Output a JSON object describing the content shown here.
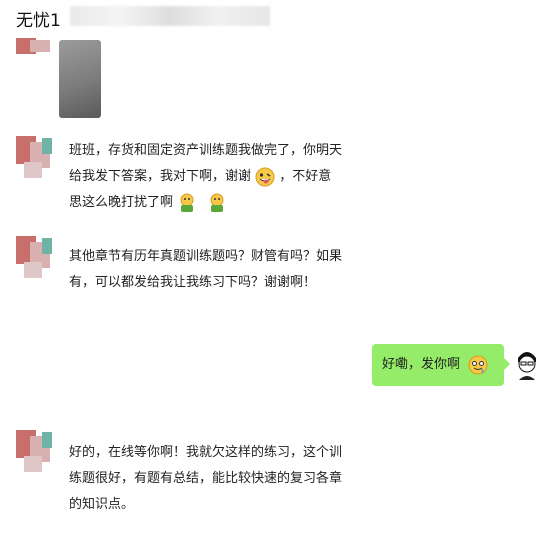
{
  "header": {
    "title": "无忧1"
  },
  "messages": [
    {
      "id": "m1",
      "type": "image"
    },
    {
      "id": "m2",
      "side": "left",
      "lines": [
        "班班，存货和固定资产训练题我做完了，你明天",
        "给我发下答案，我对下啊，谢谢",
        "，不好意",
        "思这么晚打扰了啊"
      ]
    },
    {
      "id": "m3",
      "side": "left",
      "lines": [
        "其他章节有历年真题训练题吗？财管有吗？如果",
        "有，可以都发给我让我练习下吗？谢谢啊！"
      ]
    },
    {
      "id": "m4",
      "side": "right",
      "text": "好嘞，发你啊"
    },
    {
      "id": "m5",
      "side": "left",
      "lines": [
        "好的，在线等你啊！我就欠这样的练习，这个训",
        "练题很好，有题有总结，能比较快速的复习各章",
        "的知识点。"
      ]
    }
  ],
  "icons": {
    "tongue": "tongue-emoji-icon",
    "thumb": "thumb-emoji-icon",
    "drool": "drool-emoji-icon"
  },
  "colors": {
    "bubble_self": "#95ec69",
    "background": "#ffffff"
  }
}
